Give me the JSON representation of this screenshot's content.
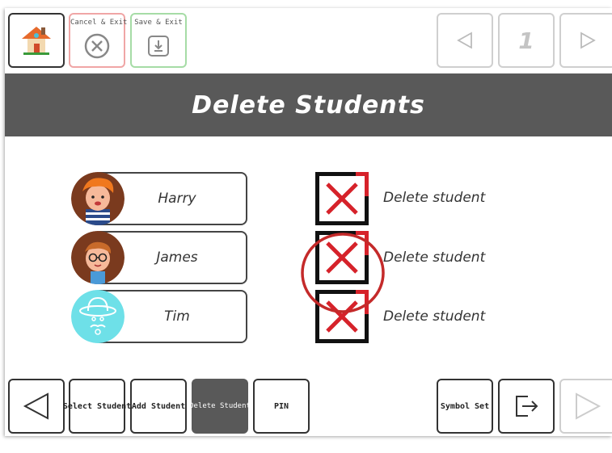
{
  "top_bar": {
    "home_icon": "house-icon",
    "cancel_label": "Cancel & Exit",
    "save_label": "Save & Exit",
    "page_number": "1"
  },
  "header": {
    "title": "Delete Students"
  },
  "students": [
    {
      "name": "Harry",
      "delete_label": "Delete student"
    },
    {
      "name": "James",
      "delete_label": "Delete student"
    },
    {
      "name": "Tim",
      "delete_label": "Delete student"
    }
  ],
  "bottom_nav": {
    "select_student": "Select Student",
    "add_student": "Add Student",
    "delete_student": "Delete Student",
    "pin": "PIN",
    "symbol_set": "Symbol Set"
  },
  "colors": {
    "header_bg": "#595959",
    "delete_red": "#d6222a",
    "cancel_border": "#f0a6a6",
    "save_border": "#a6dca6",
    "active_tab": "#595959"
  }
}
